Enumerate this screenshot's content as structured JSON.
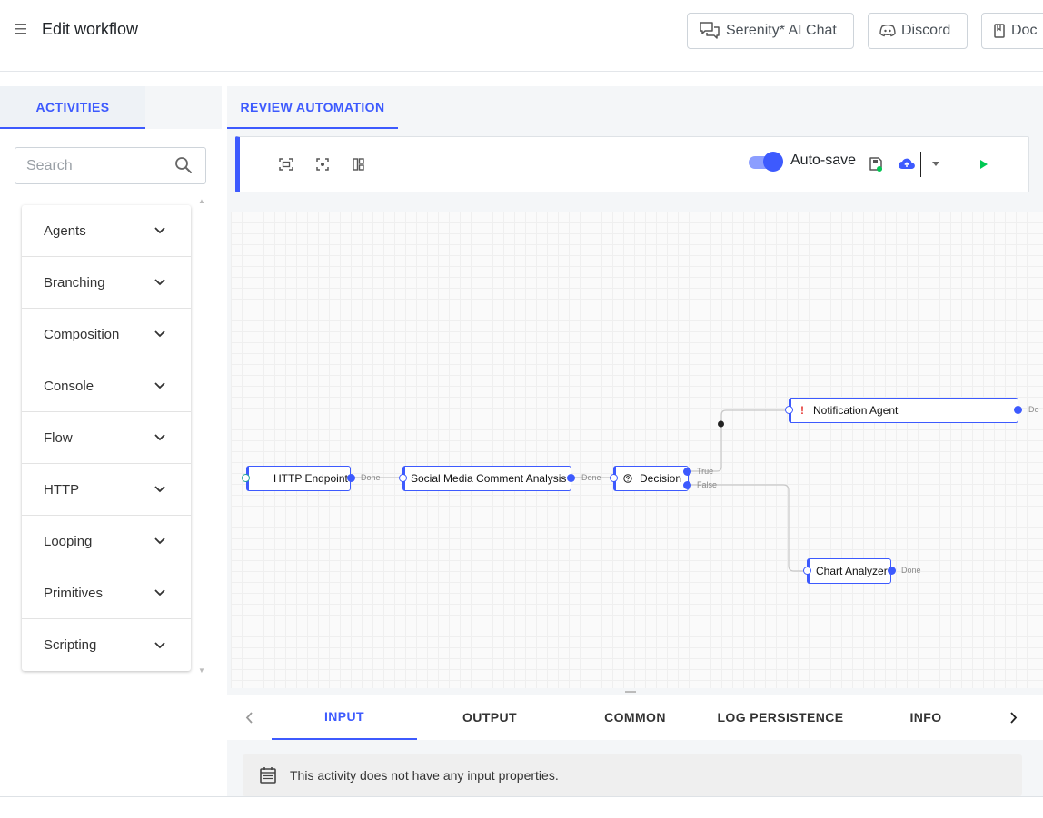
{
  "header": {
    "title": "Edit workflow",
    "buttons": {
      "ai_chat": "Serenity* AI Chat",
      "discord": "Discord",
      "docs": "Doc"
    }
  },
  "left_panel": {
    "tab": "ACTIVITIES",
    "search": {
      "placeholder": "Search",
      "value": ""
    },
    "categories": [
      "Agents",
      "Branching",
      "Composition",
      "Console",
      "Flow",
      "HTTP",
      "Looping",
      "Primitives",
      "Scripting"
    ]
  },
  "right_panel": {
    "tab": "REVIEW AUTOMATION",
    "toolbar": {
      "autosave_label": "Auto-save",
      "autosave_on": true
    },
    "workflow": {
      "nodes": {
        "http_endpoint": "HTTP Endpoint",
        "social_media": "Social Media Comment Analysis",
        "decision": "Decision",
        "notification": "Notification Agent",
        "chart_analyzer": "Chart Analyzer"
      },
      "ports": {
        "done": "Done",
        "true": "True",
        "false": "False",
        "notification_done": "Do"
      },
      "notification_warning": "!"
    },
    "bottom_tabs": [
      "INPUT",
      "OUTPUT",
      "COMMON",
      "LOG PERSISTENCE",
      "INFO"
    ],
    "active_bottom_tab": "INPUT",
    "info_message": "This activity does not have any input properties."
  },
  "colors": {
    "accent": "#3d5afe",
    "run_green": "#00c853",
    "warning_red": "#e53935"
  },
  "icons": [
    "menu-icon",
    "chat-icon",
    "discord-icon",
    "book-icon",
    "search-icon",
    "chevron-down-icon",
    "fit-screen-icon",
    "center-focus-icon",
    "layout-icon",
    "save-icon",
    "cloud-upload-icon",
    "dropdown-arrow-icon",
    "play-icon",
    "question-circle-icon",
    "chevron-left-icon",
    "chevron-right-icon",
    "calendar-list-icon"
  ]
}
